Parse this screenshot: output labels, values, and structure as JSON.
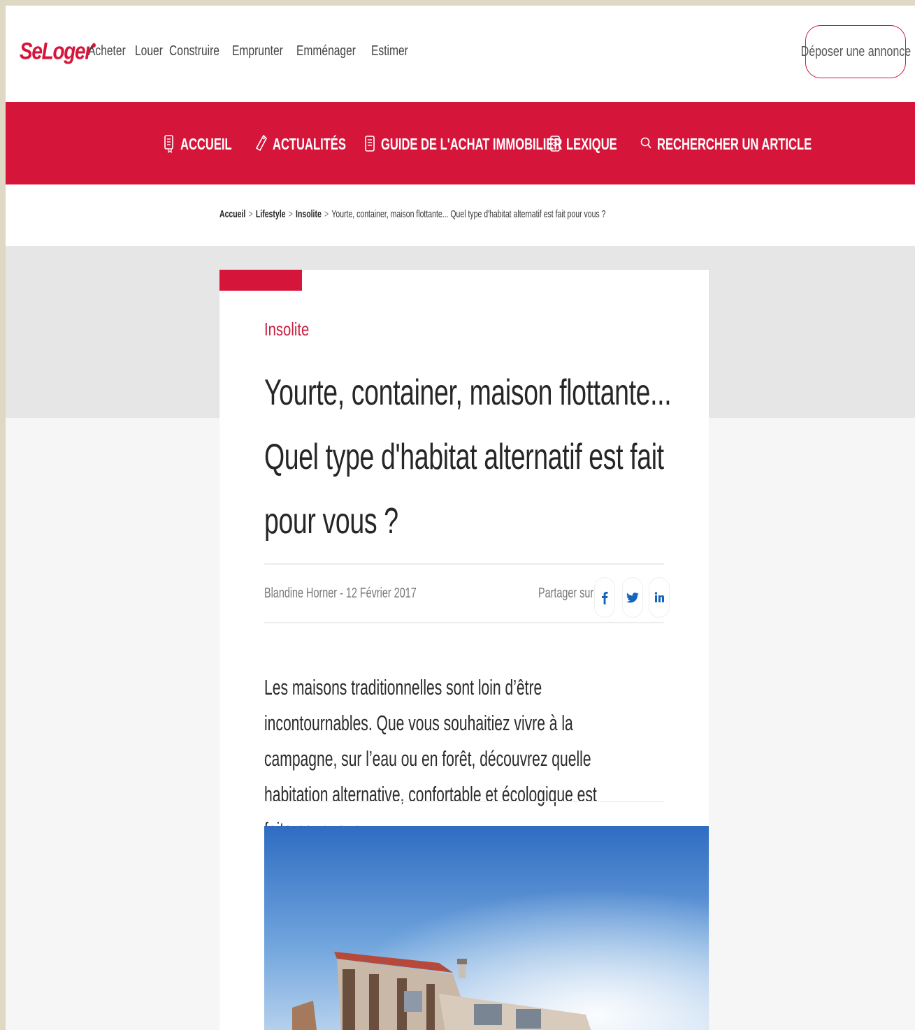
{
  "header": {
    "logo": "SeLoger",
    "logo_mark": "•",
    "nav": [
      "Acheter",
      "Louer",
      "Construire",
      "Emprunter",
      "Emménager",
      "Estimer"
    ],
    "post_button": "Déposer une annonce"
  },
  "rednav": {
    "items": [
      {
        "label": "ACCUEIL",
        "icon": "document-icon"
      },
      {
        "label": "ACTUALITÉS",
        "icon": "tag-icon"
      },
      {
        "label": "GUIDE DE L'ACHAT IMMOBILIER",
        "icon": "book-icon"
      },
      {
        "label": "LEXIQUE",
        "icon": "book-icon"
      },
      {
        "label": "RECHERCHER UN ARTICLE",
        "icon": "search-icon"
      }
    ]
  },
  "breadcrumb": {
    "items": [
      "Accueil",
      "Lifestyle",
      "Insolite"
    ],
    "current": "Yourte, container, maison flottante... Quel type d'habitat alternatif est fait pour vous ?",
    "separator": ">"
  },
  "article": {
    "category": "Insolite",
    "title": "Yourte, container, maison flottante... Quel type d'habitat alternatif est fait pour vous ?",
    "meta": "Blandine Horner - 12 Février 2017",
    "share_label": "Partager sur",
    "share": [
      "facebook-icon",
      "twitter-icon",
      "linkedin-icon"
    ],
    "lead": "Les maisons traditionnelles sont loin d’être incontournables. Que vous souhaitiez vivre à la campagne, sur l’eau ou en forêt, découvrez quelle habitation alternative, confortable et écologique est faite pour vous."
  },
  "colors": {
    "brand": "#d6153a",
    "category": "#c81d3f"
  }
}
